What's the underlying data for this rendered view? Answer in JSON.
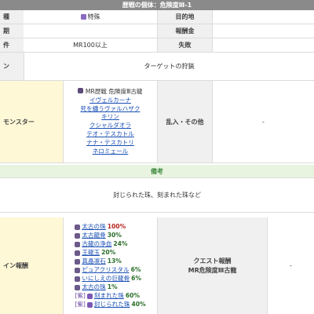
{
  "header": {
    "title": "歴戦の個体：危険度Ⅲ-1"
  },
  "rows": {
    "r1": {
      "left_label": "種",
      "left_value": "特殊",
      "right_label": "目的地",
      "right_value": ""
    },
    "r2": {
      "left_label": "期",
      "left_value": "",
      "right_label": "報酬金",
      "right_value": ""
    },
    "r3": {
      "left_label": "件",
      "left_value": "MR100以上",
      "right_label": "失敗",
      "right_value": ""
    },
    "r4": {
      "left_label": "ン",
      "left_value": "ターゲットの狩猟"
    }
  },
  "monsters": {
    "label": "モンスター",
    "right_label": "乱入・その他",
    "right_value": "-",
    "items": [
      "MR歴戦 危険度Ⅲ古龍",
      "イヴェルカーナ",
      "死を纏うヴァルハザク",
      "キリン",
      "クシャルダオラ",
      "テオ・テスカトル",
      "ナナ・テスカトリ",
      "ネロミェール"
    ]
  },
  "notes": {
    "header": "備考",
    "text": "封じられた珠、刻まれた珠など"
  },
  "rewards": {
    "label": "イン報酬",
    "right_label": "クエスト報酬",
    "right_sub": "MR危険度Ⅲ古龍",
    "right_value": "-",
    "items": [
      {
        "prefix": "",
        "name": "太古の珠",
        "pct": "100%",
        "red": true
      },
      {
        "prefix": "",
        "name": "太古龍骨",
        "pct": "30%"
      },
      {
        "prefix": "",
        "name": "古龍の浄血",
        "pct": "24%"
      },
      {
        "prefix": "",
        "name": "王龍玉",
        "pct": "20%"
      },
      {
        "prefix": "",
        "name": "真晶凛石",
        "pct": "13%"
      },
      {
        "prefix": "",
        "name": "ピュアクリスタル",
        "pct": "6%"
      },
      {
        "prefix": "",
        "name": "いにしえの巨龍骨",
        "pct": "6%"
      },
      {
        "prefix": "",
        "name": "太古の珠",
        "pct": "1%"
      },
      {
        "prefix": "[紫]",
        "name": "刻まれた珠",
        "pct": "60%"
      },
      {
        "prefix": "[紫]",
        "name": "封じられた珠",
        "pct": "40%"
      }
    ]
  }
}
